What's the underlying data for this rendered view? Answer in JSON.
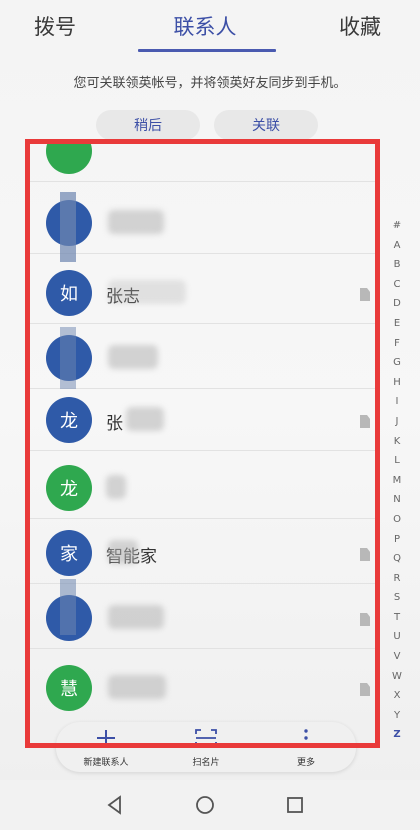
{
  "tabs": [
    {
      "label": "拨号"
    },
    {
      "label": "联系人"
    },
    {
      "label": "收藏"
    }
  ],
  "notice": "您可关联领英帐号，并将领英好友同步到手机。",
  "buttons": {
    "later": "稍后",
    "link": "关联"
  },
  "contacts": [
    {
      "avatar_char": "",
      "color": "green",
      "name": ""
    },
    {
      "avatar_char": "",
      "color": "blue",
      "name": "",
      "has_sim": false
    },
    {
      "avatar_char": "如",
      "color": "blue",
      "name": "张志",
      "has_sim": true
    },
    {
      "avatar_char": "",
      "color": "blue",
      "name": "",
      "has_sim": false
    },
    {
      "avatar_char": "龙",
      "color": "blue",
      "name": "张",
      "has_sim": true
    },
    {
      "avatar_char": "龙",
      "color": "green",
      "name": "",
      "has_sim": false
    },
    {
      "avatar_char": "家",
      "color": "blue",
      "name": "智能家",
      "has_sim": true
    },
    {
      "avatar_char": "",
      "color": "blue",
      "name": "",
      "has_sim": true
    },
    {
      "avatar_char": "慧",
      "color": "green",
      "name": "",
      "has_sim": true
    }
  ],
  "alphabet": [
    "#",
    "A",
    "B",
    "C",
    "D",
    "E",
    "F",
    "G",
    "H",
    "I",
    "J",
    "K",
    "L",
    "M",
    "N",
    "O",
    "P",
    "Q",
    "R",
    "S",
    "T",
    "U",
    "V",
    "W",
    "X",
    "Y",
    "Z"
  ],
  "toolbar": {
    "new_contact": "新建联系人",
    "scan_card": "扫名片",
    "more": "更多"
  },
  "colors": {
    "accent": "#3c4fa6",
    "avatar_blue": "#2f5aa8",
    "avatar_green": "#2fa84f",
    "highlight": "#e93a3a"
  }
}
